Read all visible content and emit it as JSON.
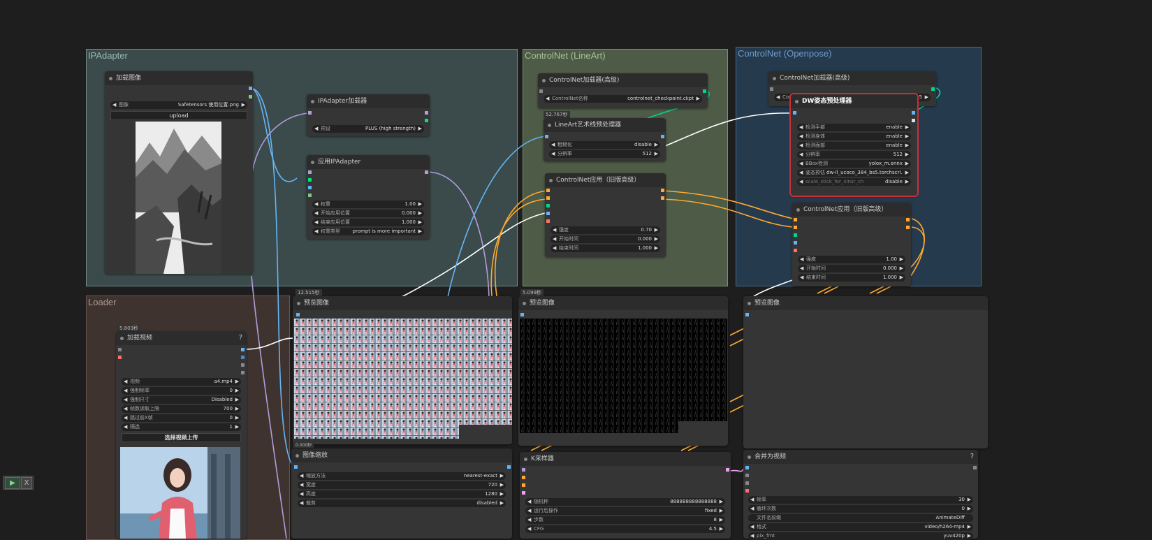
{
  "groups": {
    "ipadapter": "IPAdapter",
    "lineart": "ControlNet (LineArt)",
    "openpose": "ControlNet (Openpose)",
    "loader": "Loader"
  },
  "nodes": {
    "load_image": {
      "title": "加载图像",
      "image_label": "图像",
      "image_value": "Safetensors 使用位置.png",
      "upload": "upload"
    },
    "ipa_loader": {
      "title": "IPAdapter加载器",
      "preset_label": "预设",
      "preset_value": "PLUS (high strength)"
    },
    "ipa_apply": {
      "title": "应用IPAdapter",
      "widgets": [
        {
          "label": "权重",
          "value": "1.00"
        },
        {
          "label": "开始应用位置",
          "value": "0.000"
        },
        {
          "label": "结束应用位置",
          "value": "1.000"
        },
        {
          "label": "权重类型",
          "value": "prompt is more important"
        }
      ]
    },
    "cn_loader_la": {
      "title": "ControlNet加载器(高级)",
      "name_label": "ControlNet名称",
      "name_value": "controlnet_checkpoint.ckpt"
    },
    "lineart_pre": {
      "title": "LineArt艺术线预处理器",
      "timer": "52.767秒",
      "widgets": [
        {
          "label": "粗糙化",
          "value": "disable"
        },
        {
          "label": "分辨率",
          "value": "512"
        }
      ]
    },
    "cn_apply_la": {
      "title": "ControlNet应用（旧版高级）",
      "widgets": [
        {
          "label": "强度",
          "value": "0.70"
        },
        {
          "label": "开始时间",
          "value": "0.000"
        },
        {
          "label": "结束时间",
          "value": "1.000"
        }
      ]
    },
    "cn_loader_op": {
      "title": "ControlNet加载器(高级)",
      "name_label": "Cont",
      "name_value": "5"
    },
    "dw_pre": {
      "title": "DW姿态预处理器",
      "widgets": [
        {
          "label": "检测手部",
          "value": "enable"
        },
        {
          "label": "检测身体",
          "value": "enable"
        },
        {
          "label": "检测面部",
          "value": "enable"
        },
        {
          "label": "分辨率",
          "value": "512"
        },
        {
          "label": "BBox检测",
          "value": "yolox_m.onnx"
        },
        {
          "label": "姿态预估",
          "value": "dw-ll_ucoco_384_bs5.torchscri..."
        },
        {
          "label": "scale_stick_for_xinsr_cn",
          "value": "disable"
        }
      ]
    },
    "cn_apply_op": {
      "title": "ControlNet应用（旧版高级）",
      "widgets": [
        {
          "label": "强度",
          "value": "1.00"
        },
        {
          "label": "开始时间",
          "value": "0.000"
        },
        {
          "label": "结束时间",
          "value": "1.000"
        }
      ]
    },
    "load_video": {
      "title": "加载视频",
      "timer": "5.803秒",
      "help": "?",
      "widgets": [
        {
          "label": "视频",
          "value": "a4.mp4"
        },
        {
          "label": "强制帧率",
          "value": "0"
        },
        {
          "label": "强制尺寸",
          "value": "Disabled"
        },
        {
          "label": "帧数读取上限",
          "value": "700"
        },
        {
          "label": "跳过前X帧",
          "value": "0"
        },
        {
          "label": "隔选",
          "value": "1"
        }
      ],
      "upload": "选择视频上传"
    },
    "preview1": {
      "title": "预览图像",
      "timer": "12.515秒"
    },
    "preview2": {
      "title": "预览图像",
      "timer": "5.099秒"
    },
    "preview3": {
      "title": "预览图像"
    },
    "scale": {
      "title": "图像缩放",
      "timer": "0.000秒",
      "widgets": [
        {
          "label": "缩放方法",
          "value": "nearest-exact"
        },
        {
          "label": "宽度",
          "value": "720"
        },
        {
          "label": "高度",
          "value": "1280"
        },
        {
          "label": "裁剪",
          "value": "disabled"
        }
      ]
    },
    "ksampler": {
      "title": "K采样器",
      "widgets": [
        {
          "label": "随机种",
          "value": "888888888888888"
        },
        {
          "label": "运行后操作",
          "value": "fixed"
        },
        {
          "label": "步数",
          "value": "8"
        },
        {
          "label": "CFG",
          "value": "4.5"
        }
      ]
    },
    "combine": {
      "title": "合并为视频",
      "help": "?",
      "widgets": [
        {
          "label": "帧率",
          "value": "30"
        },
        {
          "label": "循环次数",
          "value": "0"
        },
        {
          "label": "文件名前缀",
          "value": "AnimateDiff",
          "center": true
        },
        {
          "label": "格式",
          "value": "video/h264-mp4"
        },
        {
          "label": "pix_fmt",
          "value": "yuv420p"
        }
      ]
    }
  },
  "toolbar": {
    "play": "▶",
    "close": "X"
  },
  "colors": {
    "ipadapter_group": "#3b4a4a",
    "lineart_group": "#4e5b46",
    "openpose_group": "#263a4d",
    "loader_group": "#3f3330",
    "image_link": "#64b5f6",
    "conditioning_link": "#ffa931",
    "model_link": "#b39ddb",
    "controlnet_link": "#00d78d",
    "selected_outline": "#c8303a"
  }
}
